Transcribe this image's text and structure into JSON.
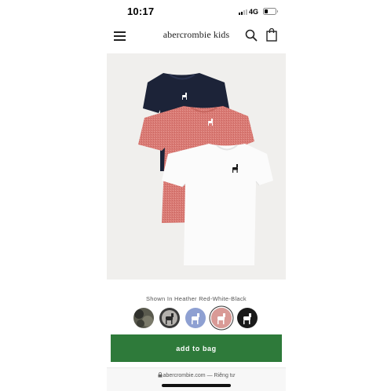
{
  "status_bar": {
    "time": "10:17",
    "network": "4G"
  },
  "header": {
    "logo": "abercrombie kids"
  },
  "product": {
    "shown_in": "Shown In Heather Red-White-Black",
    "swatches": [
      {
        "name": "camo",
        "color": "#4a4a42"
      },
      {
        "name": "grey",
        "color": "#b4b1ad"
      },
      {
        "name": "blue",
        "color": "#8ea0d2"
      },
      {
        "name": "heather-red",
        "color": "#d99a96",
        "selected": true
      },
      {
        "name": "black",
        "color": "#1a1a1a"
      }
    ],
    "add_to_bag": "add to bag"
  },
  "browser": {
    "domain": "abercrombie.com",
    "separator": "—",
    "privacy": "Riêng tư"
  }
}
